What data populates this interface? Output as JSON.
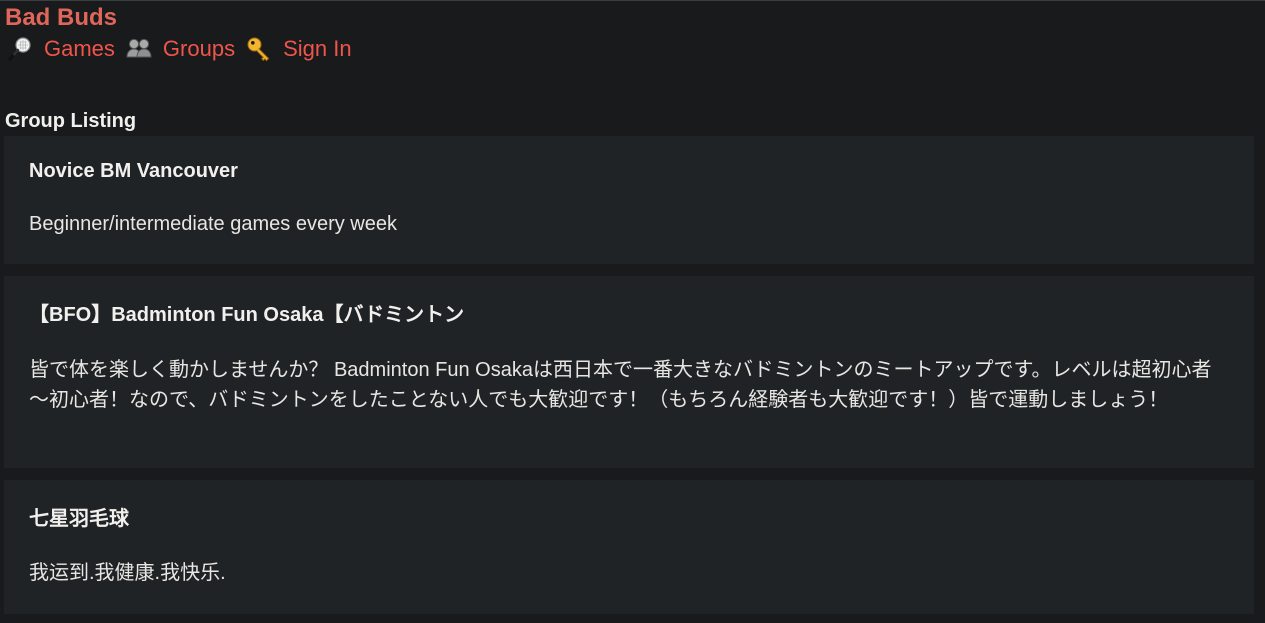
{
  "site": {
    "title": "Bad Buds"
  },
  "nav": {
    "items": [
      {
        "label": "Games",
        "icon": "badminton-racket-icon"
      },
      {
        "label": "Groups",
        "icon": "group-people-icon"
      },
      {
        "label": "Sign In",
        "icon": "key-icon"
      }
    ]
  },
  "main": {
    "section_title": "Group Listing",
    "groups": [
      {
        "name": "Novice BM Vancouver",
        "description": "Beginner/intermediate games every week"
      },
      {
        "name": "【BFO】Badminton Fun Osaka【バドミントン",
        "description": "皆で体を楽しく動かしませんか？ Badminton Fun Osakaは西日本で一番大きなバドミントンのミートアップです。レベルは超初心者～初心者！なので、バドミントンをしたことない人でも大歓迎です！（もちろん経験者も大歓迎です！）皆で運動しましょう！"
      },
      {
        "name": "七星羽毛球",
        "description": "我运到.我健康.我快乐."
      }
    ]
  },
  "colors": {
    "background": "#181a1b",
    "card": "#1f2326",
    "brand": "#e0665c",
    "link": "#f0544b",
    "text": "#e8e6e3"
  }
}
